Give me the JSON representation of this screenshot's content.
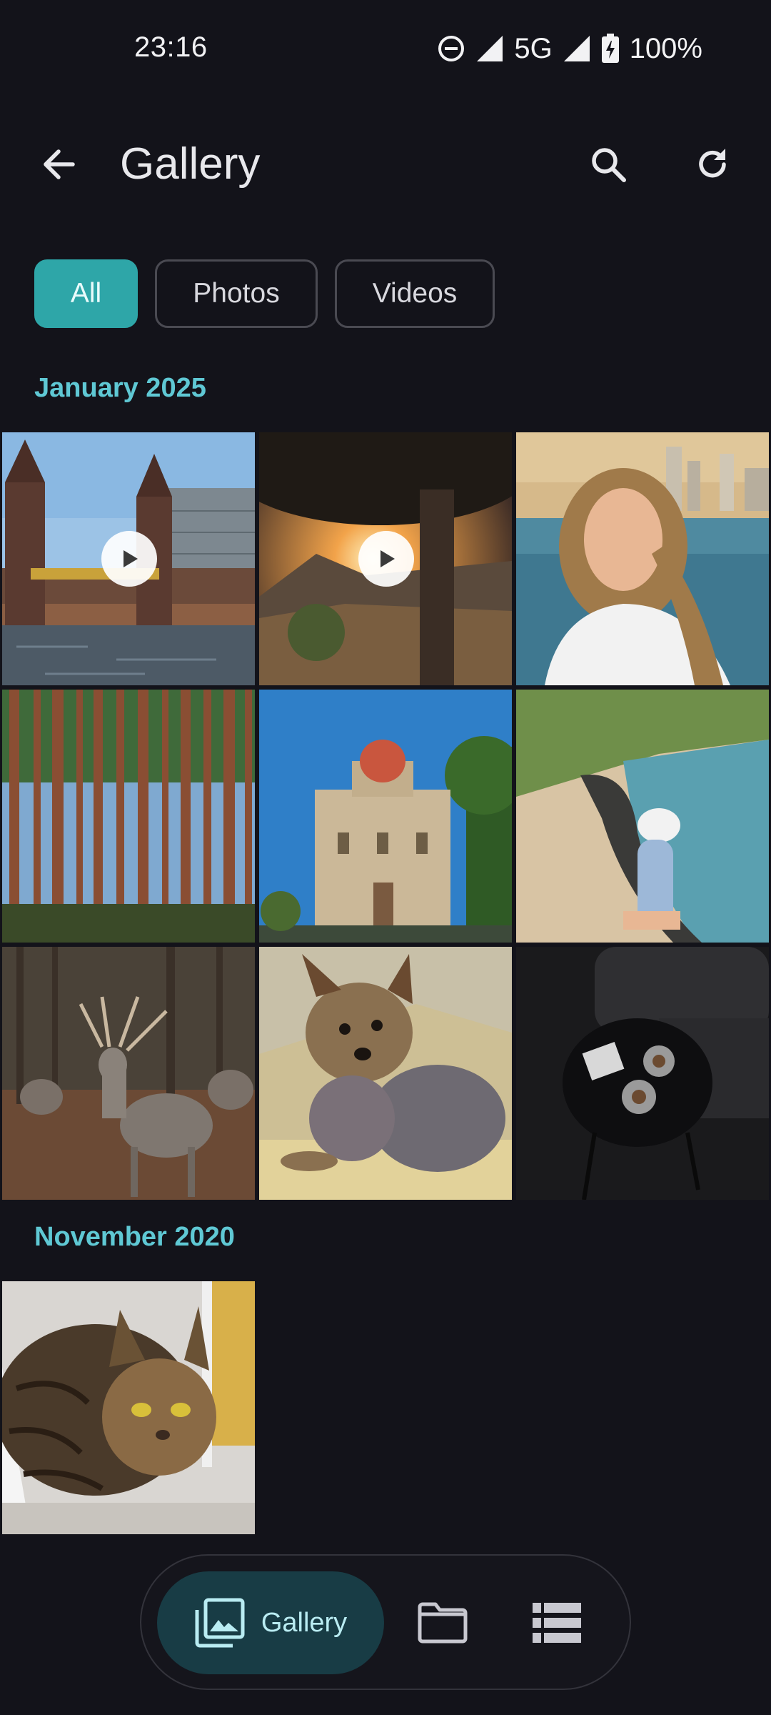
{
  "status_bar": {
    "time": "23:16",
    "network": "5G",
    "battery": "100%",
    "icons": [
      "do-not-disturb-icon",
      "signal-icon",
      "signal-icon",
      "battery-charging-icon"
    ]
  },
  "app_bar": {
    "title": "Gallery",
    "back_icon": "arrow-back-icon",
    "search_icon": "search-icon",
    "refresh_icon": "refresh-icon"
  },
  "filters": [
    {
      "label": "All",
      "selected": true
    },
    {
      "label": "Photos",
      "selected": false
    },
    {
      "label": "Videos",
      "selected": false
    }
  ],
  "sections": [
    {
      "title": "January 2025",
      "items": [
        {
          "subject": "bridge-towers",
          "type": "video"
        },
        {
          "subject": "sunset-tree",
          "type": "video"
        },
        {
          "subject": "woman-selfie-sea",
          "type": "photo"
        },
        {
          "subject": "pine-forest",
          "type": "photo"
        },
        {
          "subject": "church-red-dome",
          "type": "photo"
        },
        {
          "subject": "woman-coast",
          "type": "photo"
        },
        {
          "subject": "deer-herd",
          "type": "photo"
        },
        {
          "subject": "yorkshire-terrier",
          "type": "photo"
        },
        {
          "subject": "coffee-table",
          "type": "photo"
        }
      ]
    },
    {
      "title": "November 2020",
      "items": [
        {
          "subject": "tabby-cat",
          "type": "photo"
        }
      ]
    }
  ],
  "bottom_nav": {
    "items": [
      {
        "label": "Gallery",
        "icon": "photo-library-icon",
        "selected": true
      },
      {
        "label": "",
        "icon": "folder-icon",
        "selected": false
      },
      {
        "label": "",
        "icon": "list-icon",
        "selected": false
      }
    ]
  },
  "colors": {
    "background": "#13131a",
    "accent": "#2ea6a8",
    "section_header": "#5fc8d4",
    "nav_selected": "#183c45"
  }
}
